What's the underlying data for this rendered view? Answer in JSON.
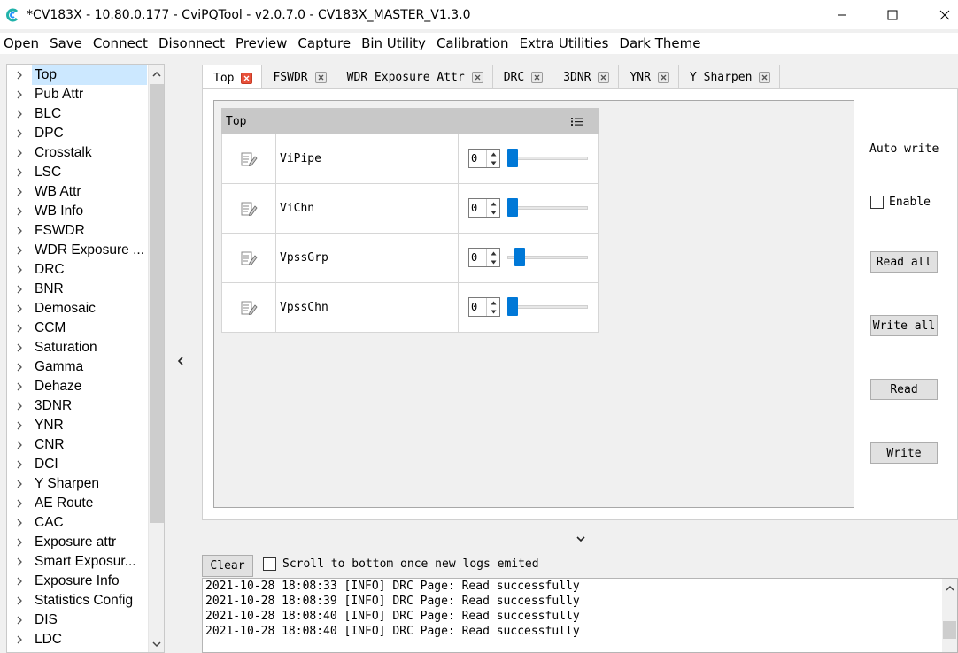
{
  "window": {
    "title": "*CV183X - 10.80.0.177 - CviPQTool - v2.0.7.0 - CV183X_MASTER_V1.3.0"
  },
  "menu": [
    "Open",
    "Save",
    "Connect",
    "Disonnect",
    "Preview",
    "Capture",
    "Bin Utility",
    "Calibration",
    "Extra Utilities",
    "Dark Theme"
  ],
  "sidebar": {
    "selected": "Top",
    "items": [
      "Top",
      "Pub Attr",
      "BLC",
      "DPC",
      "Crosstalk",
      "LSC",
      "WB Attr",
      "WB Info",
      "FSWDR",
      "WDR Exposure ...",
      "DRC",
      "BNR",
      "Demosaic",
      "CCM",
      "Saturation",
      "Gamma",
      "Dehaze",
      "3DNR",
      "YNR",
      "CNR",
      "DCI",
      "Y Sharpen",
      "AE Route",
      "CAC",
      "Exposure attr",
      "Smart Exposur...",
      "Exposure Info",
      "Statistics Config",
      "DIS",
      "LDC"
    ]
  },
  "tabs": [
    "Top",
    "FSWDR",
    "WDR Exposure Attr",
    "DRC",
    "3DNR",
    "YNR",
    "Y Sharpen"
  ],
  "active_tab": "Top",
  "group": {
    "title": "Top",
    "params": [
      {
        "name": "ViPipe",
        "value": "0"
      },
      {
        "name": "ViChn",
        "value": "0"
      },
      {
        "name": "VpssGrp",
        "value": "0"
      },
      {
        "name": "VpssChn",
        "value": "0"
      }
    ]
  },
  "controls": {
    "auto_write_label": "Auto write",
    "enable_label": "Enable",
    "read_all": "Read all",
    "write_all": "Write all",
    "read": "Read",
    "write": "Write"
  },
  "log": {
    "clear_label": "Clear",
    "scroll_label": "Scroll to bottom once new logs emited",
    "lines": [
      "2021-10-28 18:08:33 [INFO] DRC Page: Read successfully",
      "2021-10-28 18:08:39 [INFO] DRC Page: Read successfully",
      "2021-10-28 18:08:40 [INFO] DRC Page: Read successfully",
      "2021-10-28 18:08:40 [INFO] DRC Page: Read successfully"
    ]
  },
  "colors": {
    "accent": "#0078d7",
    "selection": "#cce8ff",
    "tab_close_active": "#e8503a"
  },
  "icons": {
    "app": "cvi-logo-icon",
    "tree_expander": "chevron-right-icon",
    "param_row": "edit-list-icon",
    "group_menu": "list-menu-icon"
  }
}
